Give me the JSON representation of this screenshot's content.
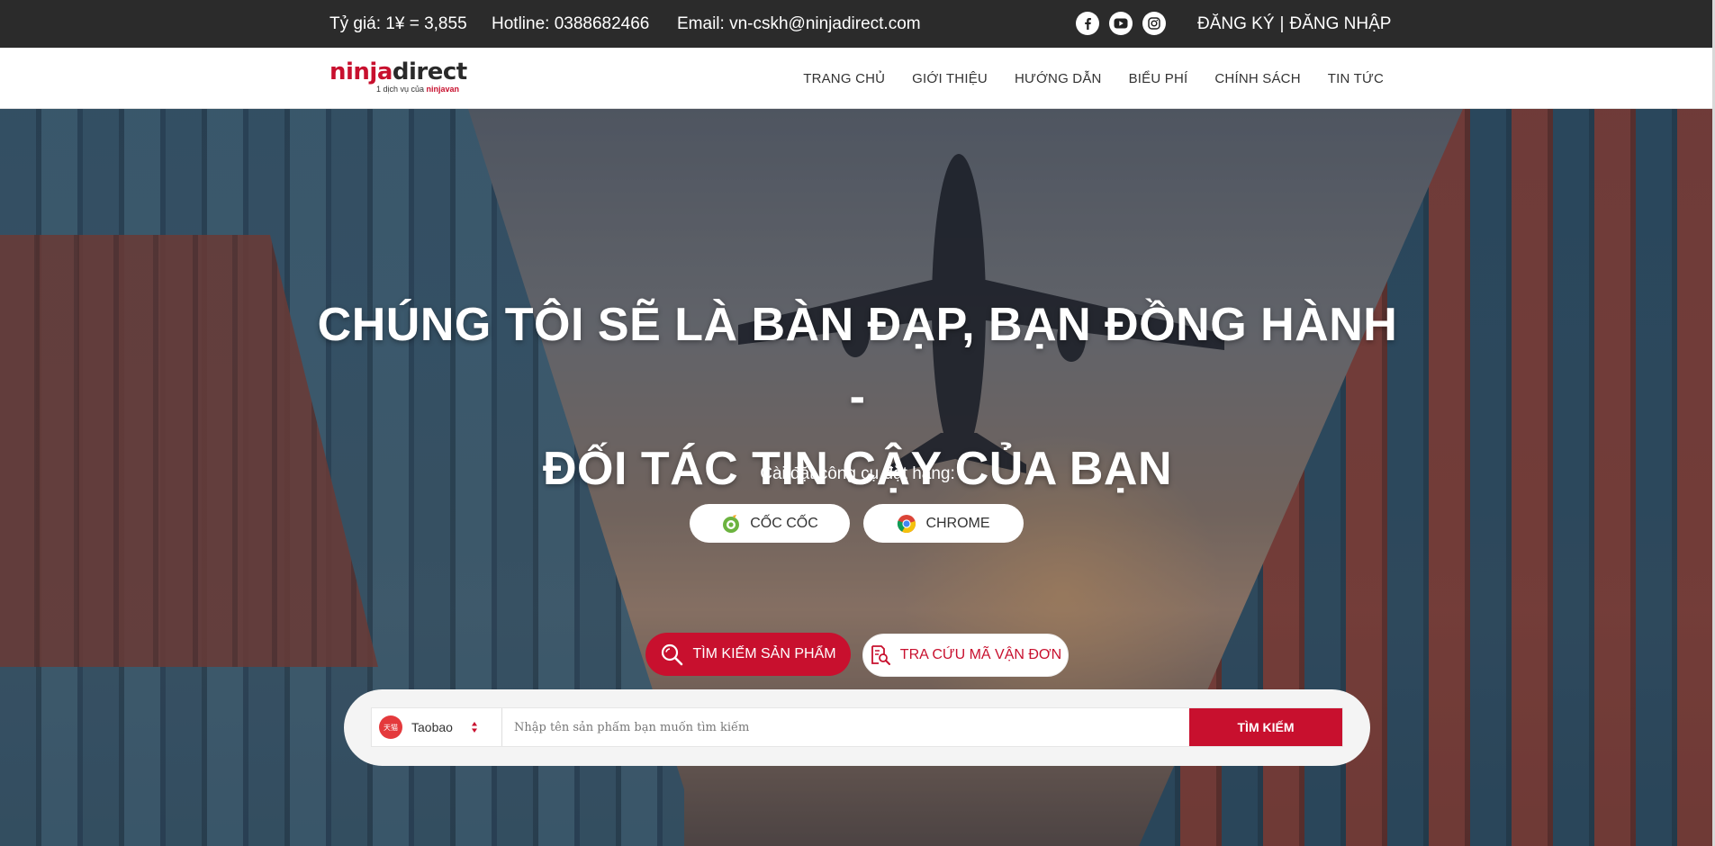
{
  "topbar": {
    "rate": "Tỷ giá: 1¥ = 3,855",
    "hotline": "Hotline: 0388682466",
    "email": "Email: vn-cskh@ninjadirect.com",
    "socials": [
      "facebook-icon",
      "youtube-icon",
      "instagram-icon"
    ],
    "register": "ĐĂNG KÝ",
    "separator": "|",
    "login": "ĐĂNG NHẬP"
  },
  "header": {
    "logo": {
      "word_ninja": "ninja",
      "word_direct": "direct",
      "tagline_prefix": "1 dịch vụ của ",
      "tagline_brand": "ninjavan"
    },
    "nav": [
      "TRANG CHỦ",
      "GIỚI THIỆU",
      "HƯỚNG DẪN",
      "BIỂU PHÍ",
      "CHÍNH SÁCH",
      "TIN TỨC"
    ]
  },
  "hero": {
    "headline_line1": "CHÚNG TÔI SẼ LÀ BÀN ĐẠP, BẠN ĐỒNG HÀNH -",
    "headline_line2": "ĐỐI TÁC TIN CẬY CỦA BẠN",
    "install_label": "Cài đặt công cụ đặt hàng:",
    "browsers": [
      {
        "label": "CỐC CỐC",
        "icon": "coccoc-icon"
      },
      {
        "label": "CHROME",
        "icon": "chrome-icon"
      }
    ],
    "tabs": {
      "search": "TÌM KIẾM SẢN PHẨM",
      "track": "TRA CỨU MÃ VẬN ĐƠN"
    },
    "search": {
      "site": "Taobao",
      "site_logo_text": "天猫",
      "placeholder": "Nhập tên sản phẩm bạn muốn tìm kiếm",
      "value": "",
      "submit": "TÌM KIẾM"
    }
  },
  "colors": {
    "brand_red": "#c8102e",
    "topbar_bg": "#2b2b2b",
    "white": "#ffffff"
  }
}
